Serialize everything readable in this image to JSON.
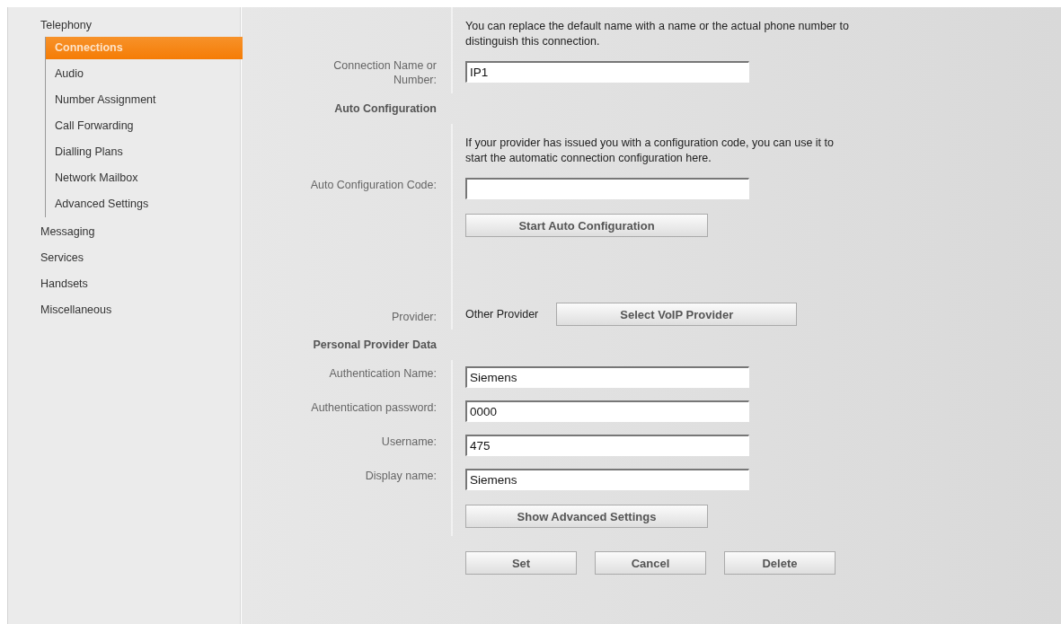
{
  "sidebar": {
    "items": [
      {
        "label": "Telephony",
        "children": [
          {
            "label": "Connections",
            "selected": true
          },
          {
            "label": "Audio",
            "selected": false
          },
          {
            "label": "Number Assignment",
            "selected": false
          },
          {
            "label": "Call Forwarding",
            "selected": false
          },
          {
            "label": "Dialling Plans",
            "selected": false
          },
          {
            "label": "Network Mailbox",
            "selected": false
          },
          {
            "label": "Advanced Settings",
            "selected": false
          }
        ]
      },
      {
        "label": "Messaging"
      },
      {
        "label": "Services"
      },
      {
        "label": "Handsets"
      },
      {
        "label": "Miscellaneous"
      }
    ]
  },
  "form": {
    "rows": [
      {
        "kind": "description",
        "text": "You can replace the default name with a name or the actual phone number to distinguish this connection."
      },
      {
        "kind": "field",
        "label": "Connection Name or Number:",
        "value": "IP1"
      },
      {
        "kind": "section",
        "label": "Auto Configuration"
      },
      {
        "kind": "description",
        "text": "If your provider has issued you with a configuration code, you can use it to start the automatic connection configuration here."
      },
      {
        "kind": "field",
        "label": "Auto Configuration Code:",
        "value": ""
      },
      {
        "kind": "button",
        "button": "Start Auto Configuration"
      },
      {
        "kind": "provider",
        "label": "Provider:",
        "value": "Other Provider",
        "button": "Select VoIP Provider"
      },
      {
        "kind": "section",
        "label": "Personal Provider Data"
      },
      {
        "kind": "field",
        "label": "Authentication Name:",
        "value": "Siemens"
      },
      {
        "kind": "field",
        "label": "Authentication password:",
        "value": "0000"
      },
      {
        "kind": "field",
        "label": "Username:",
        "value": "475"
      },
      {
        "kind": "field",
        "label": "Display name:",
        "value": "Siemens"
      },
      {
        "kind": "button",
        "button": "Show Advanced Settings"
      },
      {
        "kind": "actions",
        "buttons": [
          "Set",
          "Cancel",
          "Delete"
        ]
      }
    ]
  }
}
